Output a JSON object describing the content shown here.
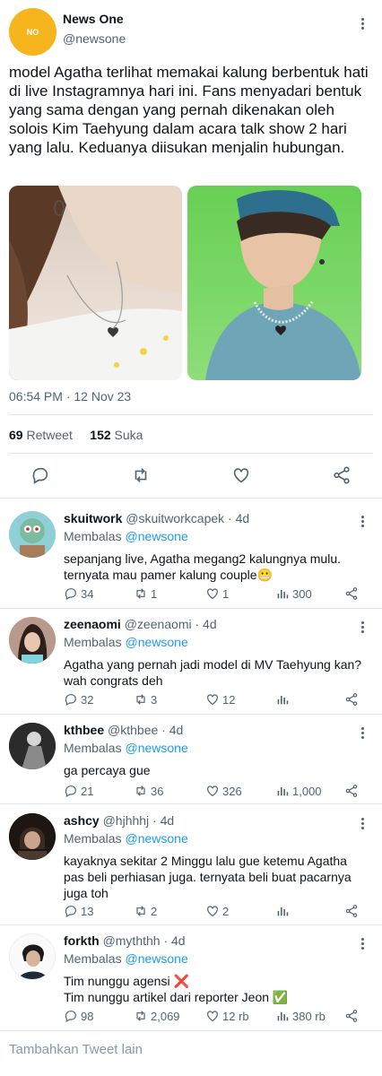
{
  "tweet": {
    "author_name": "News One",
    "author_handle": "@newsone",
    "avatar_text": "NO",
    "text": "model Agatha terlihat memakai kalung berbentuk hati di live Instagramnya hari ini. Fans menyadari bentuk yang sama dengan yang pernah dikenakan oleh solois Kim Taehyung dalam acara talk show 2 hari yang lalu. Keduanya diisukan menjalin hubungan.",
    "timestamp": "06:54 PM · 12 Nov 23",
    "retweets_count": "69",
    "retweets_label": "Retweet",
    "likes_count": "152",
    "likes_label": "Suka"
  },
  "replies": [
    {
      "name": "skuitwork",
      "handle": "@skuitworkcapek · 4d",
      "replying_label": "Membalas",
      "replying_to": "@newsone",
      "text": "sepanjang live, Agatha megang2 kalungnya mulu.\nternyata mau pamer kalung couple😬",
      "reply_count": "34",
      "retweet_count": "1",
      "like_count": "1",
      "view_count": "300"
    },
    {
      "name": "zeenaomi",
      "handle": "@zeenaomi · 4d",
      "replying_label": "Membalas",
      "replying_to": "@newsone",
      "text": "Agatha yang pernah jadi model di MV Taehyung kan?\nwah congrats deh",
      "reply_count": "32",
      "retweet_count": "3",
      "like_count": "12",
      "view_count": ""
    },
    {
      "name": "kthbee",
      "handle": "@kthbee · 4d",
      "replying_label": "Membalas",
      "replying_to": "@newsone",
      "text": "ga percaya gue",
      "reply_count": "21",
      "retweet_count": "36",
      "like_count": "326",
      "view_count": "1,000"
    },
    {
      "name": "ashcy",
      "handle": "@hjhhhj · 4d",
      "replying_label": "Membalas",
      "replying_to": "@newsone",
      "text": "kayaknya sekitar 2 Minggu lalu gue ketemu Agatha\npas beli perhiasan juga. ternyata beli buat pacarnya\njuga toh",
      "reply_count": "13",
      "retweet_count": "2",
      "like_count": "2",
      "view_count": ""
    },
    {
      "name": "forkth",
      "handle": "@myththh · 4d",
      "replying_label": "Membalas",
      "replying_to": "@newsone",
      "text": "Tim nunggu agensi ❌\nTim nunggu artikel dari reporter Jeon ✅",
      "reply_count": "98",
      "retweet_count": "2,069",
      "like_count": "12 rb",
      "view_count": "380 rb"
    }
  ],
  "composer": {
    "placeholder": "Tambahkan Tweet lain"
  },
  "colors": {
    "accent": "#1d9bf0",
    "muted": "#536471",
    "avatar_main": "#f6b51c"
  }
}
